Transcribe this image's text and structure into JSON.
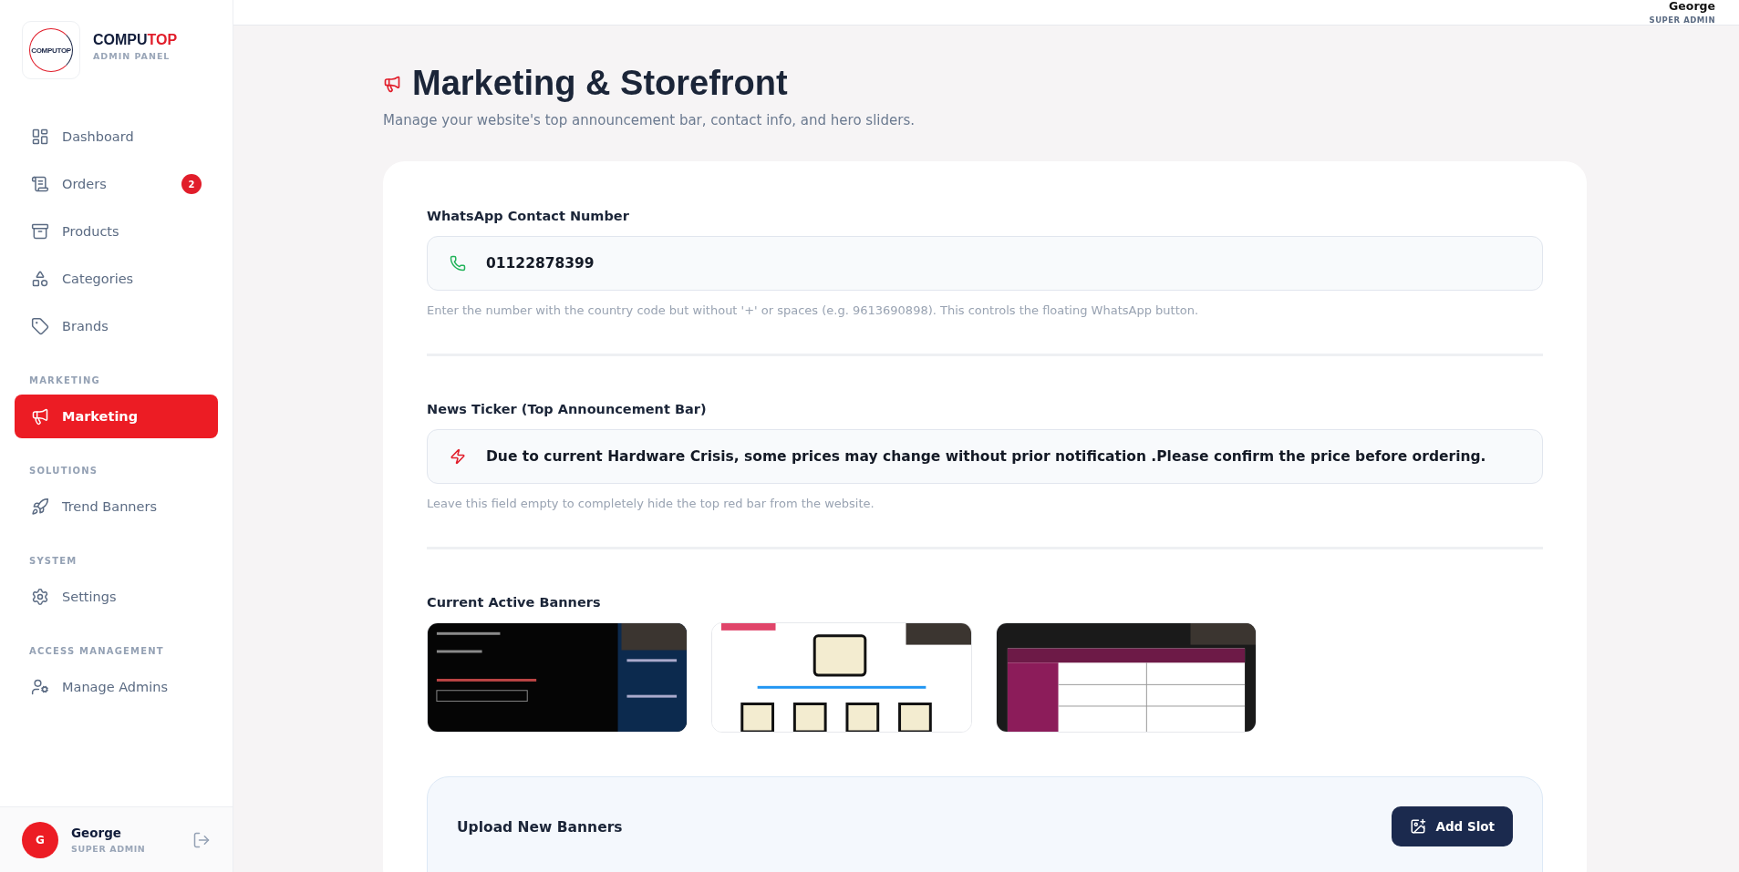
{
  "brand": {
    "logo_text": "COMPUTOP",
    "name_parts": [
      "COMPU",
      "TOP"
    ],
    "subtitle": "ADMIN PANEL"
  },
  "nav": [
    {
      "items": [
        {
          "label": "Dashboard",
          "selected": false
        },
        {
          "label": "Orders",
          "selected": false,
          "badge": "2"
        },
        {
          "label": "Products",
          "selected": false
        },
        {
          "label": "Categories",
          "selected": false
        },
        {
          "label": "Brands",
          "selected": false
        }
      ]
    },
    {
      "section": "MARKETING",
      "items": [
        {
          "label": "Marketing",
          "selected": true
        }
      ]
    },
    {
      "section": "SOLUTIONS",
      "items": [
        {
          "label": "Trend Banners",
          "selected": false
        }
      ]
    },
    {
      "section": "SYSTEM",
      "items": [
        {
          "label": "Settings",
          "selected": false
        }
      ]
    },
    {
      "section": "ACCESS MANAGEMENT",
      "items": [
        {
          "label": "Manage Admins",
          "selected": false
        }
      ]
    }
  ],
  "sidebar_user": {
    "initial": "G",
    "name": "George",
    "role": "SUPER ADMIN"
  },
  "header_user": {
    "name": "George",
    "role": "SUPER ADMIN"
  },
  "page": {
    "title": "Marketing & Storefront",
    "subtitle": "Manage your website's top announcement bar, contact info, and hero sliders."
  },
  "whatsapp": {
    "label": "WhatsApp Contact Number",
    "value": "01122878399",
    "hint": "Enter the number with the country code but without '+' or spaces (e.g. 9613690898). This controls the floating WhatsApp button."
  },
  "ticker": {
    "label": "News Ticker (Top Announcement Bar)",
    "value": "Due to current Hardware Crisis, some prices may change without prior notification .Please confirm the price before ordering.",
    "hint": "Leave this field empty to completely hide the top red bar from the website."
  },
  "banners": {
    "title": "Current Active Banners"
  },
  "upload": {
    "title": "Upload New Banners",
    "button": "Add Slot"
  }
}
